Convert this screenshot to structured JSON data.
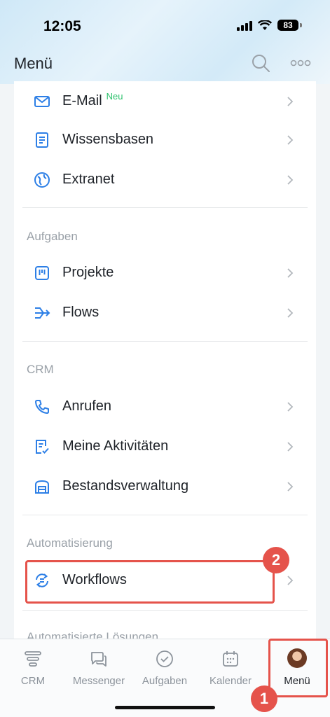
{
  "status_bar": {
    "time": "12:05",
    "battery": "83"
  },
  "header": {
    "title": "Menü"
  },
  "menu": {
    "rows_top": [
      {
        "label": "E-Mail",
        "badge": "Neu",
        "icon": "mail-icon"
      },
      {
        "label": "Wissensbasen",
        "icon": "book-icon"
      },
      {
        "label": "Extranet",
        "icon": "globe-icon"
      }
    ],
    "sections": {
      "tasks": {
        "title": "Aufgaben",
        "items": [
          {
            "label": "Projekte",
            "icon": "project-board-icon"
          },
          {
            "label": "Flows",
            "icon": "flows-icon"
          }
        ]
      },
      "crm": {
        "title": "CRM",
        "items": [
          {
            "label": "Anrufen",
            "icon": "phone-icon"
          },
          {
            "label": "Meine Aktivitäten",
            "icon": "activities-icon"
          },
          {
            "label": "Bestandsverwaltung",
            "icon": "warehouse-icon"
          }
        ]
      },
      "automation": {
        "title": "Automatisierung",
        "items": [
          {
            "label": "Workflows",
            "icon": "workflow-icon"
          }
        ]
      },
      "solutions": {
        "title": "Automatisierte Lösungen"
      }
    }
  },
  "annotations": {
    "step1": "1",
    "step2": "2"
  },
  "tabbar": {
    "tabs": [
      {
        "label": "CRM",
        "icon": "crm-funnel-icon"
      },
      {
        "label": "Messenger",
        "icon": "chat-icon"
      },
      {
        "label": "Aufgaben",
        "icon": "check-circle-icon"
      },
      {
        "label": "Kalender",
        "icon": "calendar-icon"
      },
      {
        "label": "Menü",
        "icon": "avatar"
      }
    ]
  },
  "colors": {
    "accent": "#2d7fe6",
    "highlight": "#e5534b",
    "new_badge": "#2fc26e"
  }
}
